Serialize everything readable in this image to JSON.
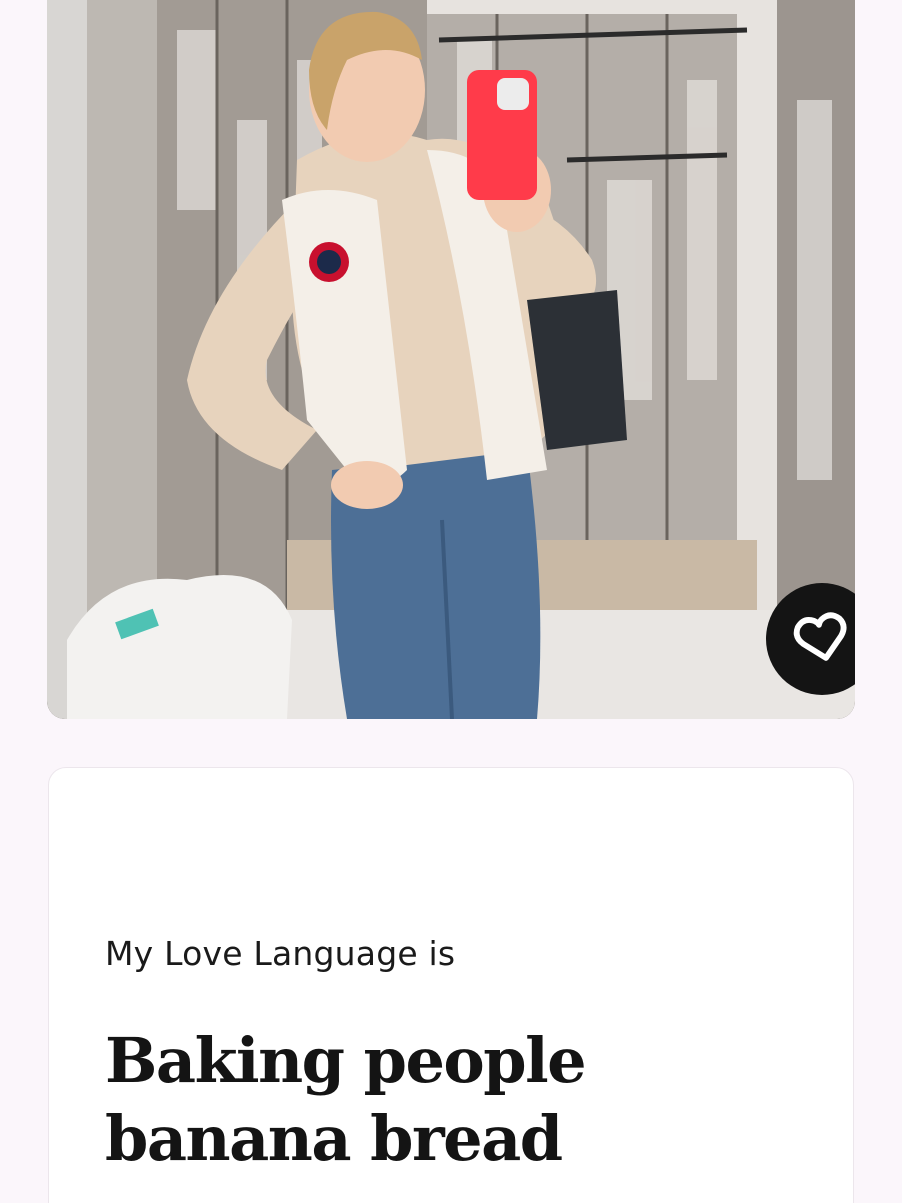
{
  "profile": {
    "photo": {
      "description_icon": "photo-image",
      "like_button_icon": "heart-icon"
    },
    "prompt": {
      "question": "My Love Language is",
      "answer": "Baking people banana bread"
    }
  },
  "colors": {
    "background": "#fbf6fb",
    "like_button": "#141414",
    "card": "#ffffff",
    "text": "#141414"
  }
}
